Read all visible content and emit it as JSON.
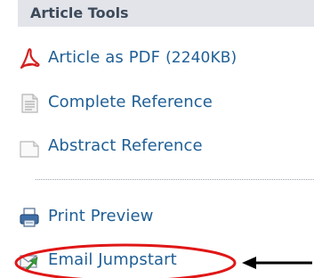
{
  "panel": {
    "title": "Article Tools",
    "items": [
      {
        "label": "Article as PDF",
        "size": "(2240KB)",
        "icon": "pdf-icon"
      },
      {
        "label": "Complete Reference",
        "icon": "document-icon"
      },
      {
        "label": "Abstract Reference",
        "icon": "blank-document-icon"
      },
      {
        "label": "Print Preview",
        "icon": "printer-icon"
      },
      {
        "label": "Email Jumpstart",
        "icon": "email-arrow-icon"
      }
    ]
  },
  "colors": {
    "link": "#1f5f96",
    "header_bg": "#e2e4ea",
    "header_text": "#3d4a5a",
    "annotation": "#e01616"
  }
}
